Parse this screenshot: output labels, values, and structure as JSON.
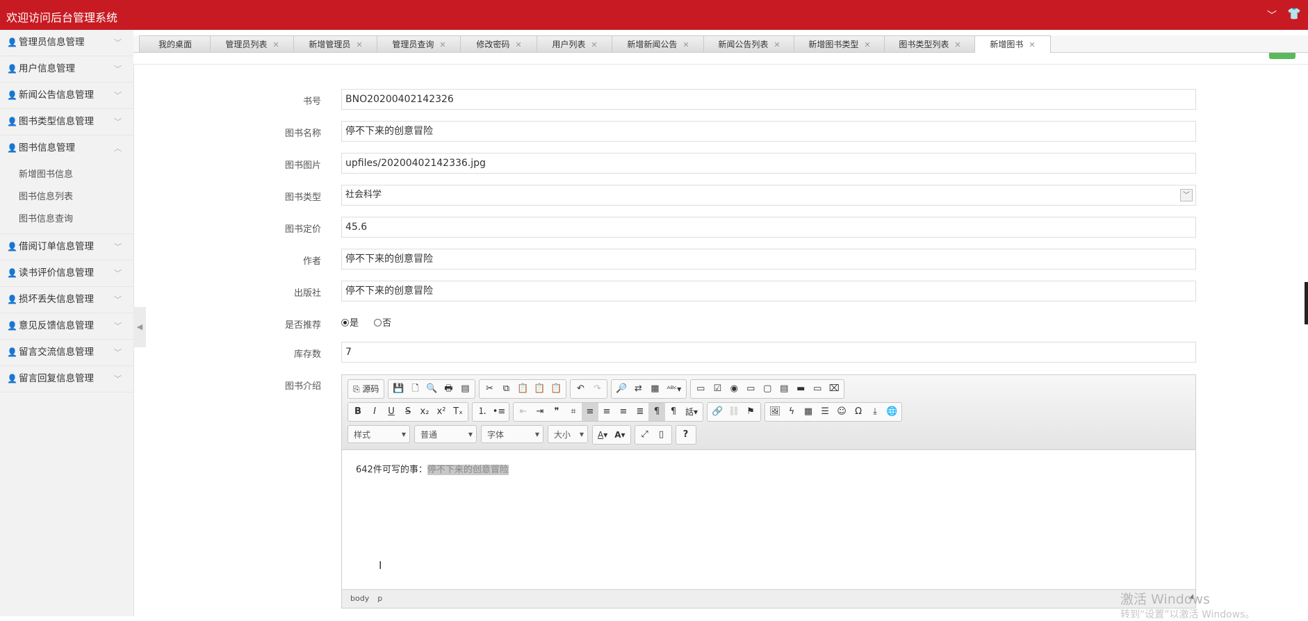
{
  "app": {
    "title": "欢迎访问后台管理系统"
  },
  "sidebar": {
    "items": [
      {
        "label": "管理员信息管理"
      },
      {
        "label": "用户信息管理"
      },
      {
        "label": "新闻公告信息管理"
      },
      {
        "label": "图书类型信息管理"
      },
      {
        "label": "图书信息管理",
        "expanded": true,
        "children": [
          "新增图书信息",
          "图书信息列表",
          "图书信息查询"
        ]
      },
      {
        "label": "借阅订单信息管理"
      },
      {
        "label": "读书评价信息管理"
      },
      {
        "label": "损坏丢失信息管理"
      },
      {
        "label": "意见反馈信息管理"
      },
      {
        "label": "留言交流信息管理"
      },
      {
        "label": "留言回复信息管理"
      }
    ]
  },
  "tabs": [
    {
      "label": "我的桌面",
      "closable": false
    },
    {
      "label": "管理员列表",
      "closable": true
    },
    {
      "label": "新增管理员",
      "closable": true
    },
    {
      "label": "管理员查询",
      "closable": true
    },
    {
      "label": "修改密码",
      "closable": true
    },
    {
      "label": "用户列表",
      "closable": true
    },
    {
      "label": "新增新闻公告",
      "closable": true
    },
    {
      "label": "新闻公告列表",
      "closable": true
    },
    {
      "label": "新增图书类型",
      "closable": true
    },
    {
      "label": "图书类型列表",
      "closable": true
    },
    {
      "label": "新增图书",
      "closable": true,
      "active": true
    }
  ],
  "form": {
    "book_no": {
      "label": "书号",
      "value": "BNO20200402142326"
    },
    "book_name": {
      "label": "图书名称",
      "value": "停不下来的创意冒险"
    },
    "book_image": {
      "label": "图书图片",
      "value": "upfiles/20200402142336.jpg"
    },
    "book_type": {
      "label": "图书类型",
      "value": "社会科学"
    },
    "price": {
      "label": "图书定价",
      "value": "45.6"
    },
    "author": {
      "label": "作者",
      "value": "停不下来的创意冒险"
    },
    "publisher": {
      "label": "出版社",
      "value": "停不下来的创意冒险"
    },
    "recommend": {
      "label": "是否推荐",
      "options": [
        "是",
        "否"
      ],
      "selected": "是"
    },
    "stock": {
      "label": "库存数",
      "value": "7"
    },
    "intro": {
      "label": "图书介绍"
    }
  },
  "editor": {
    "source_label": "源码",
    "style_combo": "样式",
    "format_combo": "普通",
    "font_combo": "字体",
    "size_combo": "大小",
    "content_prefix": "642件可写的事：",
    "content_selected": "停不下来的创意冒险",
    "status_path": [
      "body",
      "p"
    ]
  },
  "watermark": {
    "line1": "激活 Windows",
    "line2": "转到“设置”以激活 Windows。"
  }
}
